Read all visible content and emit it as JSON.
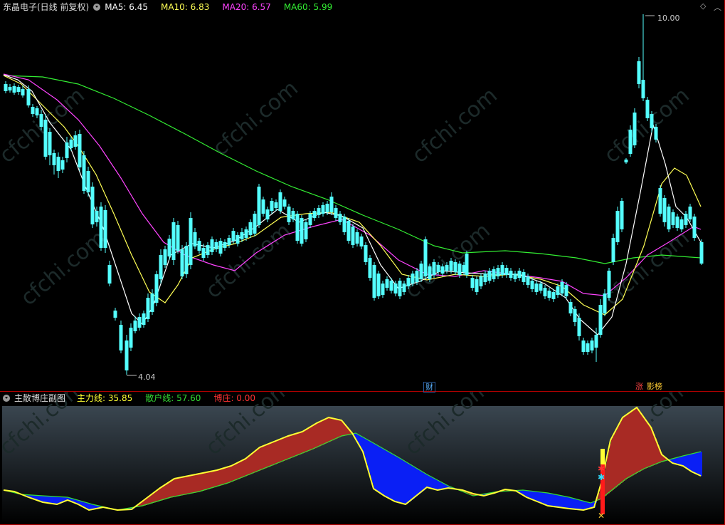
{
  "main": {
    "title": "东晶电子(日线 前复权)",
    "indicators": [
      {
        "label": "MA5: 6.45",
        "color": "#ffffff"
      },
      {
        "label": "MA10: 6.83",
        "color": "#ffff55"
      },
      {
        "label": "MA20: 6.57",
        "color": "#ff44ff"
      },
      {
        "label": "MA60: 5.99",
        "color": "#33ee33"
      }
    ],
    "high_label": "10.00",
    "low_label": "4.04",
    "tag_cai": "财",
    "tag_zhang": "涨",
    "tag_yingbang": "影榜",
    "corner_icons": [
      "diamond-icon",
      "chevron-up-icon"
    ]
  },
  "sub": {
    "title": "主散博庄副图",
    "indicators": [
      {
        "label": "主力线: 35.85",
        "color": "#ffff33"
      },
      {
        "label": "散户线: 57.60",
        "color": "#33dd33"
      },
      {
        "label": "博庄: 0.00",
        "color": "#ff3333"
      }
    ]
  },
  "watermark": "cfchi.com",
  "colors": {
    "up": "#ff4a4a",
    "down": "#54ffff",
    "ma5": "#ffffff",
    "ma10": "#ffff55",
    "ma20": "#ff44ff",
    "ma60": "#33ee33",
    "divider": "#b00000"
  }
}
